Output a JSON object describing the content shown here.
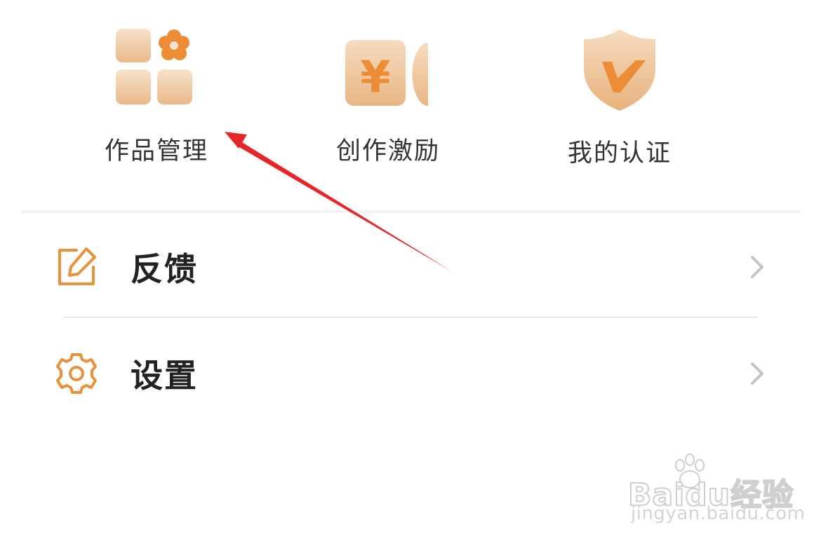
{
  "grid": {
    "items": [
      {
        "label": "作品管理",
        "icon": "apps-grid-flower-icon"
      },
      {
        "label": "创作激励",
        "icon": "yuan-coin-icon"
      },
      {
        "label": "我的认证",
        "icon": "verified-shield-icon"
      }
    ]
  },
  "menu": {
    "items": [
      {
        "label": "反馈",
        "icon": "edit-icon"
      },
      {
        "label": "设置",
        "icon": "gear-icon"
      }
    ]
  },
  "colors": {
    "accent": "#e8913a",
    "tile_gradient_top": "#f6dcc0",
    "tile_gradient_bottom": "#e8b683",
    "text_primary": "#222222",
    "chevron": "#c4c4c4",
    "annotation": "#e8262a"
  },
  "watermark": {
    "brand": "Baidu经验",
    "url": "jingyan.baidu.com"
  }
}
